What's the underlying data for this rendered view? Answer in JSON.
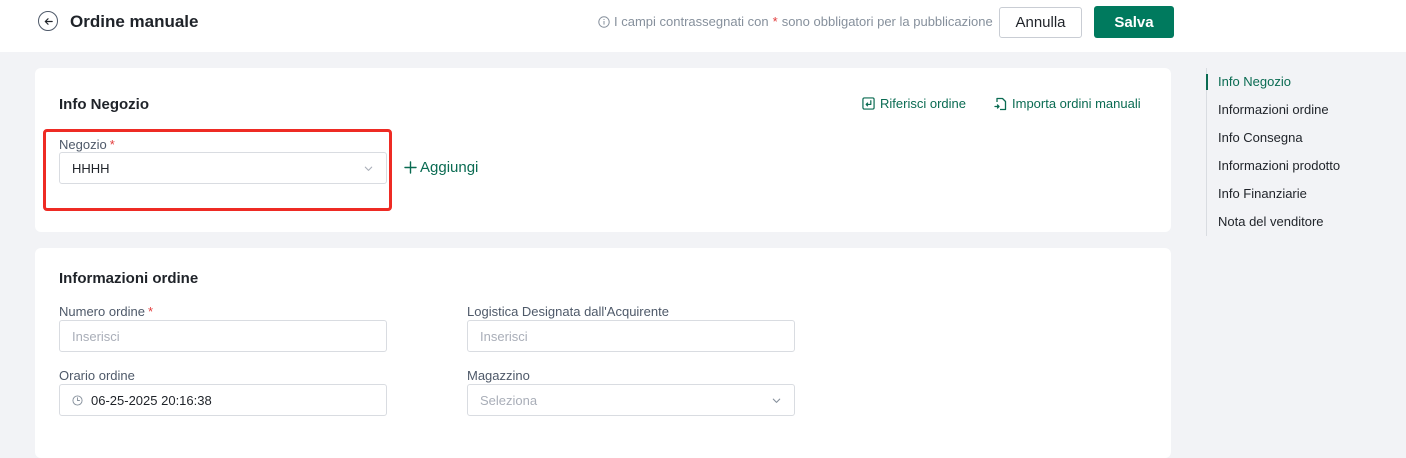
{
  "header": {
    "title": "Ordine manuale",
    "hint_prefix": "I campi contrassegnati con",
    "hint_star": "*",
    "hint_suffix": "sono obbligatori per la pubblicazione",
    "cancel_label": "Annulla",
    "save_label": "Salva"
  },
  "store_section": {
    "title": "Info Negozio",
    "refer_order_label": "Riferisci ordine",
    "import_label": "Importa ordini manuali",
    "store_field": {
      "label": "Negozio",
      "required_mark": "*",
      "value": "HHHH"
    },
    "add_label": "Aggiungi"
  },
  "order_section": {
    "title": "Informazioni ordine",
    "order_number": {
      "label": "Numero ordine",
      "required_mark": "*",
      "placeholder": "Inserisci"
    },
    "buyer_logistics": {
      "label": "Logistica Designata dall'Acquirente",
      "placeholder": "Inserisci"
    },
    "order_time": {
      "label": "Orario ordine",
      "value": "06-25-2025 20:16:38"
    },
    "warehouse": {
      "label": "Magazzino",
      "placeholder": "Seleziona"
    }
  },
  "side_nav": {
    "items": [
      {
        "label": "Info Negozio",
        "active": true
      },
      {
        "label": "Informazioni ordine"
      },
      {
        "label": "Info Consegna"
      },
      {
        "label": "Informazioni prodotto"
      },
      {
        "label": "Info Finanziarie"
      },
      {
        "label": "Nota del venditore"
      }
    ]
  },
  "colors": {
    "primary": "#007a5e",
    "link": "#0a6b52",
    "required": "#e23c3c",
    "highlight_box": "#ee2b24",
    "background": "#f2f3f6"
  }
}
